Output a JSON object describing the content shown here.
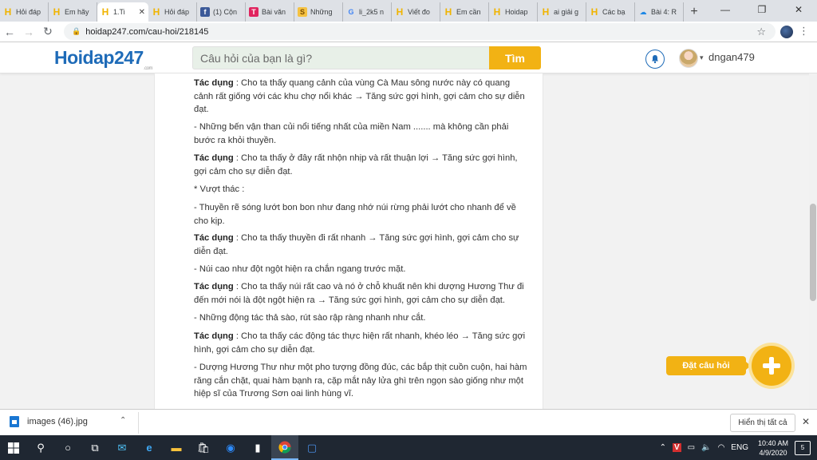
{
  "browser": {
    "tabs": [
      {
        "icon": "H",
        "label": "Hỏi đáp"
      },
      {
        "icon": "H",
        "label": "Em hãy"
      },
      {
        "icon": "H",
        "label": "1.Ti",
        "active": true
      },
      {
        "icon": "H",
        "label": "Hỏi đáp"
      },
      {
        "icon": "f",
        "label": "(1) Cộn"
      },
      {
        "icon": "T",
        "label": "Bài văn"
      },
      {
        "icon": "S",
        "label": "Những"
      },
      {
        "icon": "G",
        "label": "li_2k5 n"
      },
      {
        "icon": "H",
        "label": "Viết đo"
      },
      {
        "icon": "H",
        "label": "Em cần"
      },
      {
        "icon": "H",
        "label": "Hoidap"
      },
      {
        "icon": "H",
        "label": "ai giải g"
      },
      {
        "icon": "H",
        "label": "Các bạ"
      },
      {
        "icon": "C",
        "label": "Bài 4: R"
      }
    ],
    "url": "hoidap247.com/cau-hoi/218145"
  },
  "site": {
    "logo_main": "Hoidap247",
    "logo_sub": ".com",
    "search_placeholder": "Câu hỏi của bạn là gì?",
    "search_button": "Tìm",
    "username": "dngan479"
  },
  "content": {
    "paragraphs": [
      {
        "label": "Tác dụng",
        "text": " : Cho ta thấy quang cảnh của vùng Cà Mau sông nước này có quang cảnh rất giống với các khu chợ nổi khác → Tăng sức gợi hình, gợi cảm cho sự diễn đạt."
      },
      {
        "label": "",
        "text": "- Những bến vận than củi nổi tiếng nhất của miền Nam ....... mà không cần phải bước ra khỏi thuyền."
      },
      {
        "label": "Tác dụng",
        "text": " : Cho ta thấy ở đây rất nhộn nhịp và rất thuận lợi → Tăng sức gợi hình, gợi cảm cho sự diễn đạt."
      },
      {
        "label": "",
        "text": "* Vượt thác :"
      },
      {
        "label": "",
        "text": "- Thuyền rẽ sóng lướt bon bon như đang nhớ núi rừng phải lướt cho nhanh để về cho kịp."
      },
      {
        "label": "Tác dụng",
        "text": " : Cho ta thấy thuyền đi rất nhanh → Tăng sức gợi hình, gợi cảm cho sự diễn đạt."
      },
      {
        "label": "",
        "text": "- Núi cao như đột ngột hiện ra chắn ngang trước mặt."
      },
      {
        "label": "Tác dụng",
        "text": " : Cho ta thấy núi rất cao và nó ở chỗ khuất nên khi dượng Hương Thư đi đến mới nói là đột ngột hiện ra → Tăng sức gợi hình, gợi cảm cho sự diễn đạt."
      },
      {
        "label": "",
        "text": "- Những động tác thả sào, rút sào rập ràng nhanh như cắt."
      },
      {
        "label": "Tác dụng",
        "text": " : Cho ta thấy các động tác thực hiện rất nhanh, khéo léo → Tăng sức gợi hình, gợi cảm cho sự diễn đạt."
      },
      {
        "label": "",
        "text": "- Dượng Hương Thư như một pho tượng đồng đúc, các bắp thịt cuồn cuộn, hai hàm răng cắn chặt, quai hàm bạnh ra, cặp mắt nảy lửa ghì trên ngọn sào giống như một hiệp sĩ của Trương Sơn oai linh hùng vĩ."
      }
    ]
  },
  "ask_button": "Đặt câu hỏi",
  "downloads": {
    "file": "images (46).jpg",
    "show_all": "Hiển thị tất cả"
  },
  "taskbar": {
    "lang": "ENG",
    "time": "10:40 AM",
    "date": "4/9/2020",
    "notifications": "5"
  }
}
